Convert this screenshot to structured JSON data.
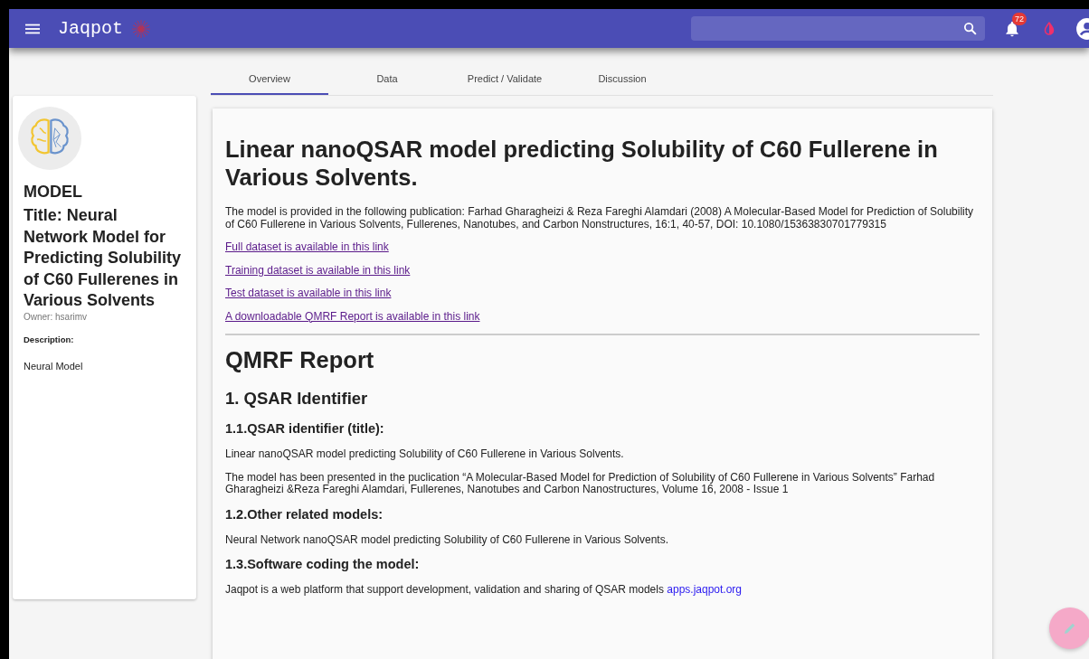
{
  "toolbar": {
    "brand": "Jaqpot",
    "notification_count": "72"
  },
  "tabs": [
    {
      "label": "Overview",
      "selected": true
    },
    {
      "label": "Data",
      "selected": false
    },
    {
      "label": "Predict / Validate",
      "selected": false
    },
    {
      "label": "Discussion",
      "selected": false
    }
  ],
  "sidebar": {
    "kind_label": "MODEL",
    "title": "Title: Neural Network Model for Predicting Solubility of C60 Fullerenes in Various Solvents",
    "owner": "Owner: hsarimv",
    "description_label": "Description:",
    "description": "Neural Model"
  },
  "content": [
    {
      "kind": "title",
      "text": "Linear nanoQSAR model predicting Solubility of C60 Fullerene in Various Solvents."
    },
    {
      "kind": "paragraph",
      "text": "The model is provided in the following publication: Farhad Gharagheizi & Reza Fareghi Alamdari (2008) A Molecular-Based Model for Prediction of Solubility of C60 Fullerene in Various Solvents, Fullerenes, Nanotubes, and Carbon Nonstructures, 16:1, 40-57, DOI: 10.1080/15363830701779315"
    },
    {
      "kind": "link",
      "text": "Full dataset is available in this link"
    },
    {
      "kind": "link",
      "text": "Training dataset is available in this link"
    },
    {
      "kind": "link",
      "text": "Test dataset is available in this link"
    },
    {
      "kind": "link",
      "text": "A downloadable QMRF Report is available in this link"
    },
    {
      "kind": "divider"
    },
    {
      "kind": "title",
      "text": "QMRF Report"
    },
    {
      "kind": "section",
      "text": "1. QSAR Identifier"
    },
    {
      "kind": "subsection",
      "text": "1.1.QSAR identifier (title):"
    },
    {
      "kind": "paragraph",
      "text": "Linear nanoQSAR model predicting Solubility of C60 Fullerene in Various Solvents."
    },
    {
      "kind": "paragraph",
      "text": "The model has been presented in the puclication “A Molecular-Based Model for Prediction of Solubility of C60 Fullerene in Various Solvents” Farhad Gharagheizi &Reza Fareghi Alamdari, Fullerenes, Nanotubes and Carbon Nanostructures, Volume 16, 2008 - Issue 1"
    },
    {
      "kind": "subsection",
      "text": "1.2.Other related models:"
    },
    {
      "kind": "paragraph",
      "text": "Neural Network nanoQSAR model predicting Solubility of C60 Fullerene in Various Solvents."
    },
    {
      "kind": "subsection",
      "text": "1.3.Software coding the model:"
    },
    {
      "kind": "paragraph_link",
      "text": "Jaqpot is a web platform that support development, validation and sharing of QSAR models",
      "link": "apps.jaqpot.org"
    }
  ]
}
